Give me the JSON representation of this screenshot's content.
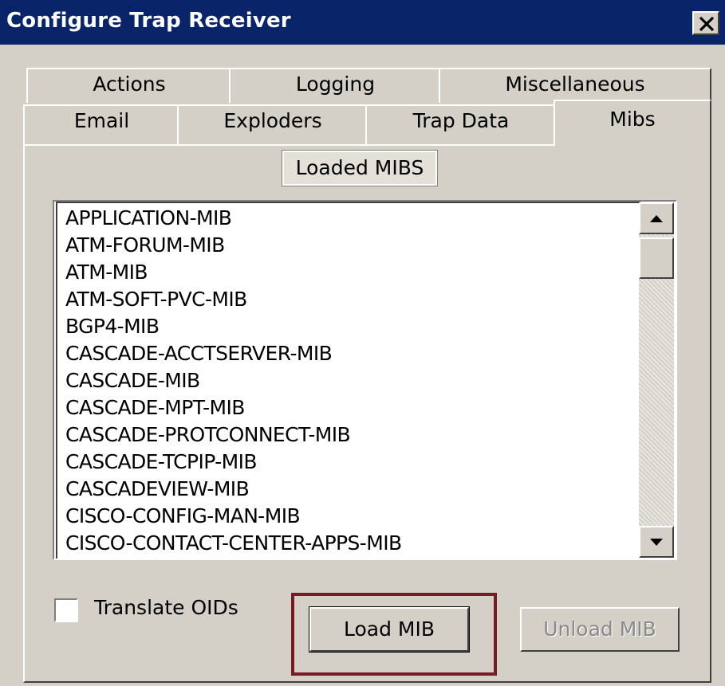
{
  "window": {
    "title": "Configure Trap Receiver"
  },
  "tabs_row1": [
    {
      "label": "Actions"
    },
    {
      "label": "Logging"
    },
    {
      "label": "Miscellaneous"
    }
  ],
  "tabs_row2": [
    {
      "label": "Email"
    },
    {
      "label": "Exploders"
    },
    {
      "label": "Trap Data"
    },
    {
      "label": "Mibs",
      "selected": true
    }
  ],
  "mibs_panel": {
    "group_label": "Loaded MIBS",
    "items": [
      "APPLICATION-MIB",
      "ATM-FORUM-MIB",
      "ATM-MIB",
      "ATM-SOFT-PVC-MIB",
      "BGP4-MIB",
      "CASCADE-ACCTSERVER-MIB",
      "CASCADE-MIB",
      "CASCADE-MPT-MIB",
      "CASCADE-PROTCONNECT-MIB",
      "CASCADE-TCPIP-MIB",
      "CASCADEVIEW-MIB",
      "CISCO-CONFIG-MAN-MIB",
      "CISCO-CONTACT-CENTER-APPS-MIB"
    ],
    "translate_oids_label": "Translate OIDs",
    "translate_oids_checked": false,
    "load_button": "Load MIB",
    "unload_button": "Unload MIB",
    "unload_enabled": false
  },
  "colors": {
    "titlebar": "#0a246a",
    "face": "#d4d0c8",
    "highlight_annotation": "#7a1a24"
  }
}
